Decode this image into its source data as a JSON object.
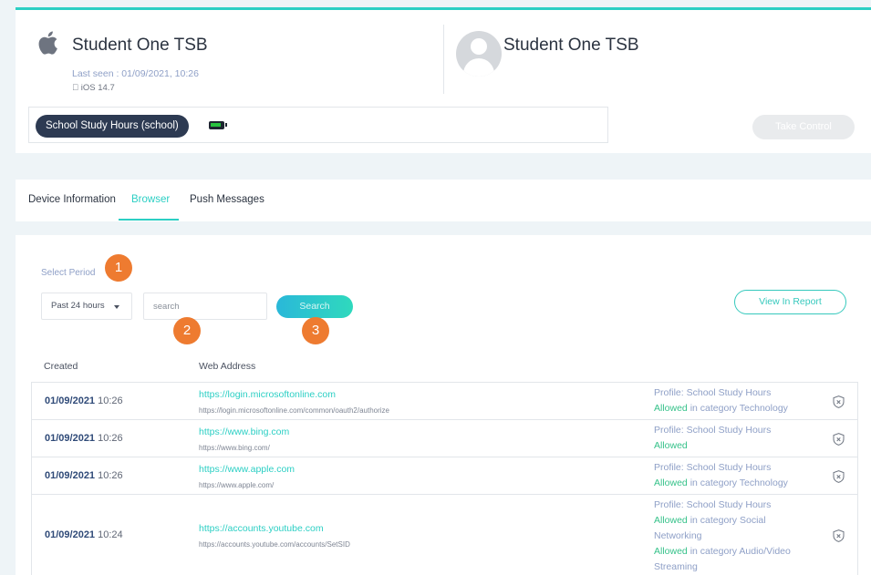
{
  "device": {
    "name": "Student One TSB",
    "last_seen": "Last seen : 01/09/2021, 10:26",
    "os": "iOS 14.7",
    "icon": "apple-icon"
  },
  "user": {
    "name": "Student One TSB",
    "icon": "avatar-icon"
  },
  "profile": {
    "name": "School Study Hours (school)",
    "battery_icon": "battery-icon"
  },
  "take_control_label": "Take Control",
  "tabs": [
    {
      "label": "Device Information",
      "active": false
    },
    {
      "label": "Browser",
      "active": true
    },
    {
      "label": "Push Messages",
      "active": false
    }
  ],
  "filters": {
    "select_period_label": "Select Period",
    "period_value": "Past 24 hours",
    "search_placeholder": "search",
    "search_button": "Search",
    "report_button": "View In Report"
  },
  "markers": [
    "1",
    "2",
    "3"
  ],
  "table": {
    "columns": [
      "Created",
      "Web Address"
    ],
    "rows": [
      {
        "date": "01/09/2021",
        "time": "10:26",
        "host": "https://login.microsoftonline.com",
        "url": "https://login.microsoftonline.com/common/oauth2/authorize",
        "profile": "Profile: School Study Hours",
        "decisions": [
          {
            "status": "Allowed",
            "detail": " in category Technology"
          }
        ]
      },
      {
        "date": "01/09/2021",
        "time": "10:26",
        "host": "https://www.bing.com",
        "url": "https://www.bing.com/",
        "profile": "Profile: School Study Hours",
        "decisions": [
          {
            "status": "Allowed",
            "detail": ""
          }
        ]
      },
      {
        "date": "01/09/2021",
        "time": "10:26",
        "host": "https://www.apple.com",
        "url": "https://www.apple.com/",
        "profile": "Profile: School Study Hours",
        "decisions": [
          {
            "status": "Allowed",
            "detail": " in category Technology"
          }
        ]
      },
      {
        "date": "01/09/2021",
        "time": "10:24",
        "host": "https://accounts.youtube.com",
        "url": "https://accounts.youtube.com/accounts/SetSID",
        "profile": "Profile: School Study Hours",
        "decisions": [
          {
            "status": "Allowed",
            "detail": " in category Social Networking"
          },
          {
            "status": "Allowed",
            "detail": " in category Audio/Video Streaming"
          }
        ]
      }
    ]
  },
  "colors": {
    "accent": "#2ccfc4",
    "marker": "#ee7b30",
    "allowed": "#36c28a",
    "pill": "#2d3a52"
  }
}
